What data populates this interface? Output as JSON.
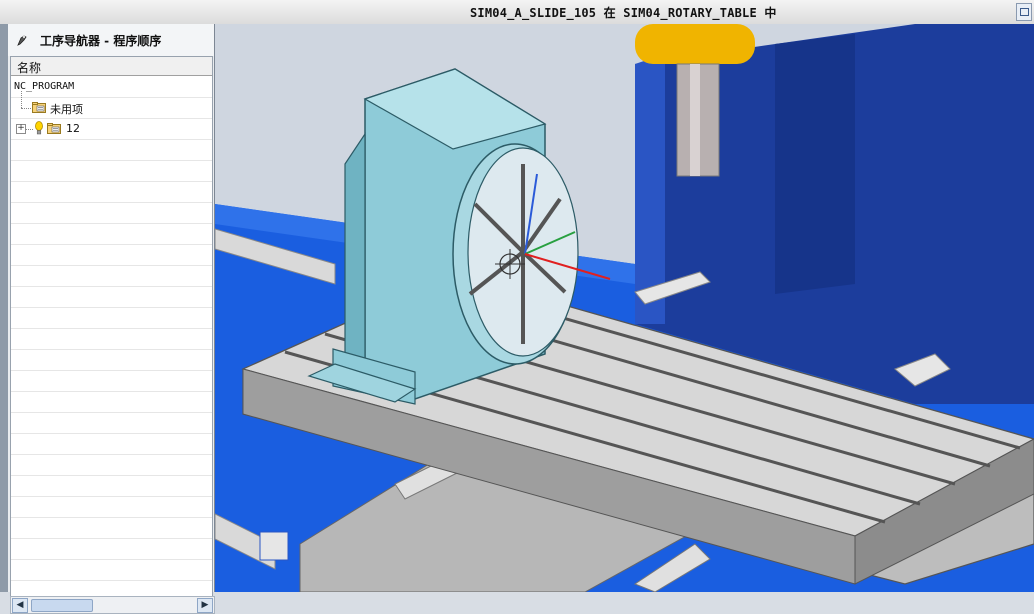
{
  "window": {
    "title": "SIM04_A_SLIDE_105 在 SIM04_ROTARY_TABLE 中"
  },
  "navigator": {
    "title": "工序导航器 - 程序顺序",
    "column_header": "名称",
    "items": [
      {
        "label": "NC_PROGRAM",
        "icon": "none"
      },
      {
        "label": "未用项",
        "icon": "folder-icon"
      },
      {
        "label": "12",
        "icon": "folder-icon",
        "status_icon": "bulb-icon",
        "expandable": true
      }
    ]
  },
  "viewport": {
    "scene": "rotary-table-on-milling-machine",
    "colors": {
      "background_blue": "#1a5ee0",
      "table_gray": "#c9c9c9",
      "rotary_body": "#8ecbd8",
      "spindle_yellow": "#f0b400",
      "column_blue": "#1c3d9c"
    }
  }
}
